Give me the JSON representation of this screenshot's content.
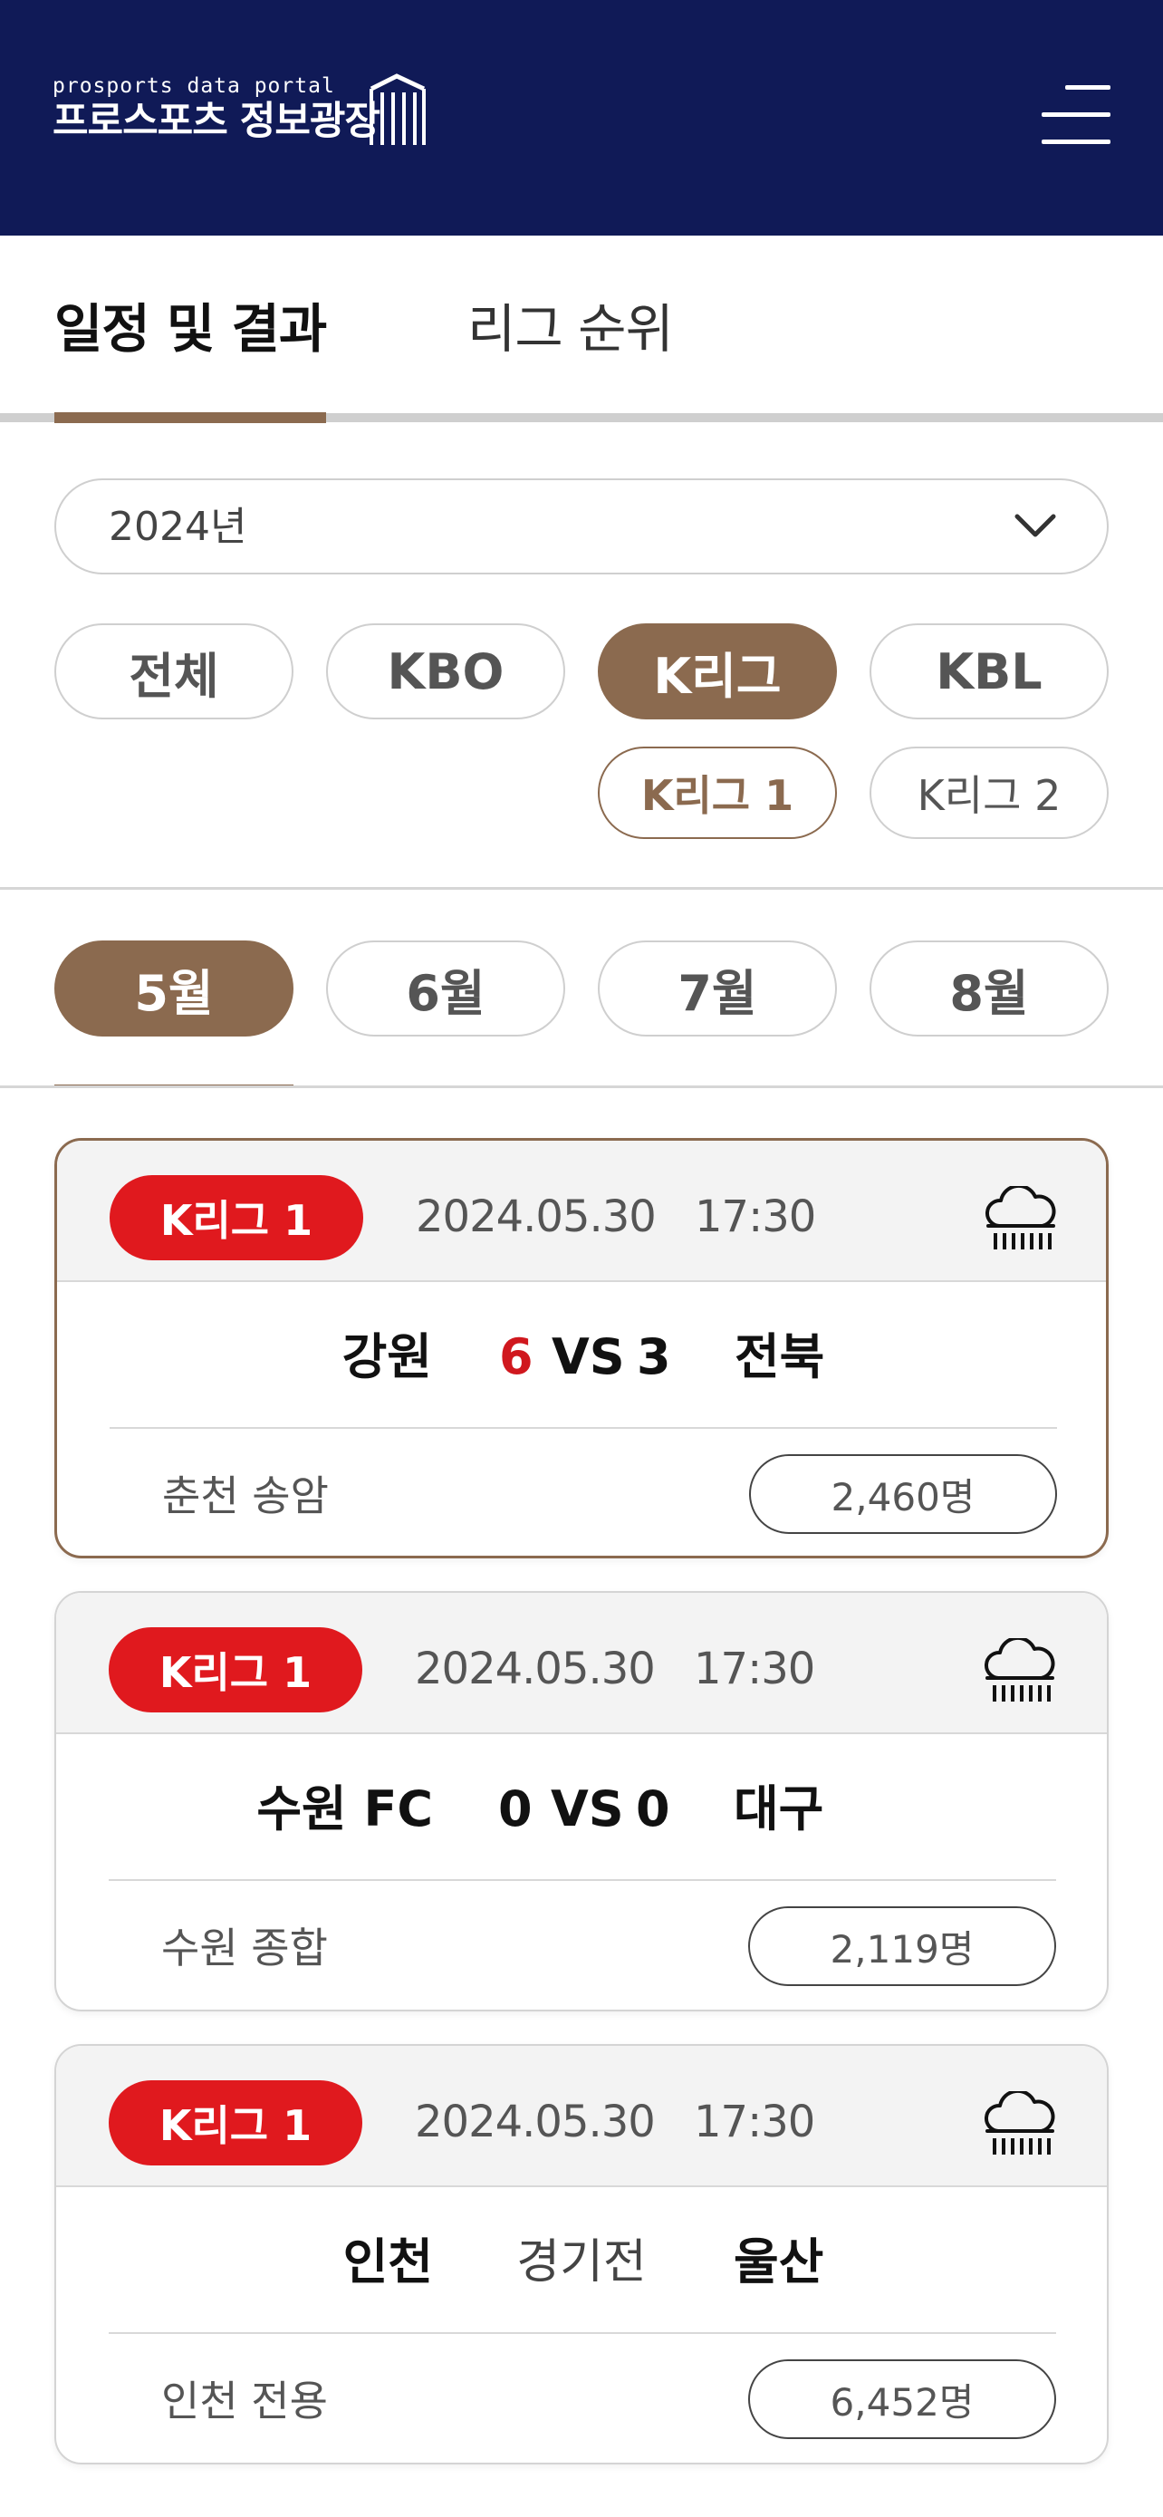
{
  "header": {
    "logo_small": "prosports data portal",
    "logo_big": "프로스포츠 정보광장",
    "menu_icon": "hamburger-menu-icon",
    "background_color": "#101a57"
  },
  "tabs": [
    {
      "label": "일정 및 결과",
      "active": true
    },
    {
      "label": "리그 순위",
      "active": false
    }
  ],
  "year_select": {
    "value": "2024년",
    "icon": "chevron-down-icon"
  },
  "leagues": [
    {
      "label": "전체",
      "active": false
    },
    {
      "label": "KBO",
      "active": false
    },
    {
      "label": "K리그",
      "active": true
    },
    {
      "label": "KBL",
      "active": false
    }
  ],
  "sub_leagues": [
    {
      "label": "K리그 1",
      "active": true
    },
    {
      "label": "K리그 2",
      "active": false
    }
  ],
  "months": [
    {
      "label": "5월",
      "active": true
    },
    {
      "label": "6월",
      "active": false
    },
    {
      "label": "7월",
      "active": false
    },
    {
      "label": "8월",
      "active": false
    }
  ],
  "accent_color": "#8b6a4f",
  "badge_color": "#e0191e",
  "matches": [
    {
      "league": "K리그 1",
      "date": "2024.05.30",
      "time": "17:30",
      "weather_icon": "rain-cloud-icon",
      "home": "강원",
      "home_score": "6",
      "vs": "VS",
      "away_score": "3",
      "away": "전북",
      "status": "",
      "stadium": "춘천 송암",
      "attendance": "2,460명"
    },
    {
      "league": "K리그 1",
      "date": "2024.05.30",
      "time": "17:30",
      "weather_icon": "rain-cloud-icon",
      "home": "수원 FC",
      "home_score": "0",
      "vs": "VS",
      "away_score": "0",
      "away": "대구",
      "status": "",
      "stadium": "수원 종합",
      "attendance": "2,119명"
    },
    {
      "league": "K리그 1",
      "date": "2024.05.30",
      "time": "17:30",
      "weather_icon": "rain-cloud-icon",
      "home": "인천",
      "home_score": "",
      "vs": "",
      "away_score": "",
      "away": "울산",
      "status": "경기전",
      "stadium": "인천 전용",
      "attendance": "6,452명"
    }
  ]
}
